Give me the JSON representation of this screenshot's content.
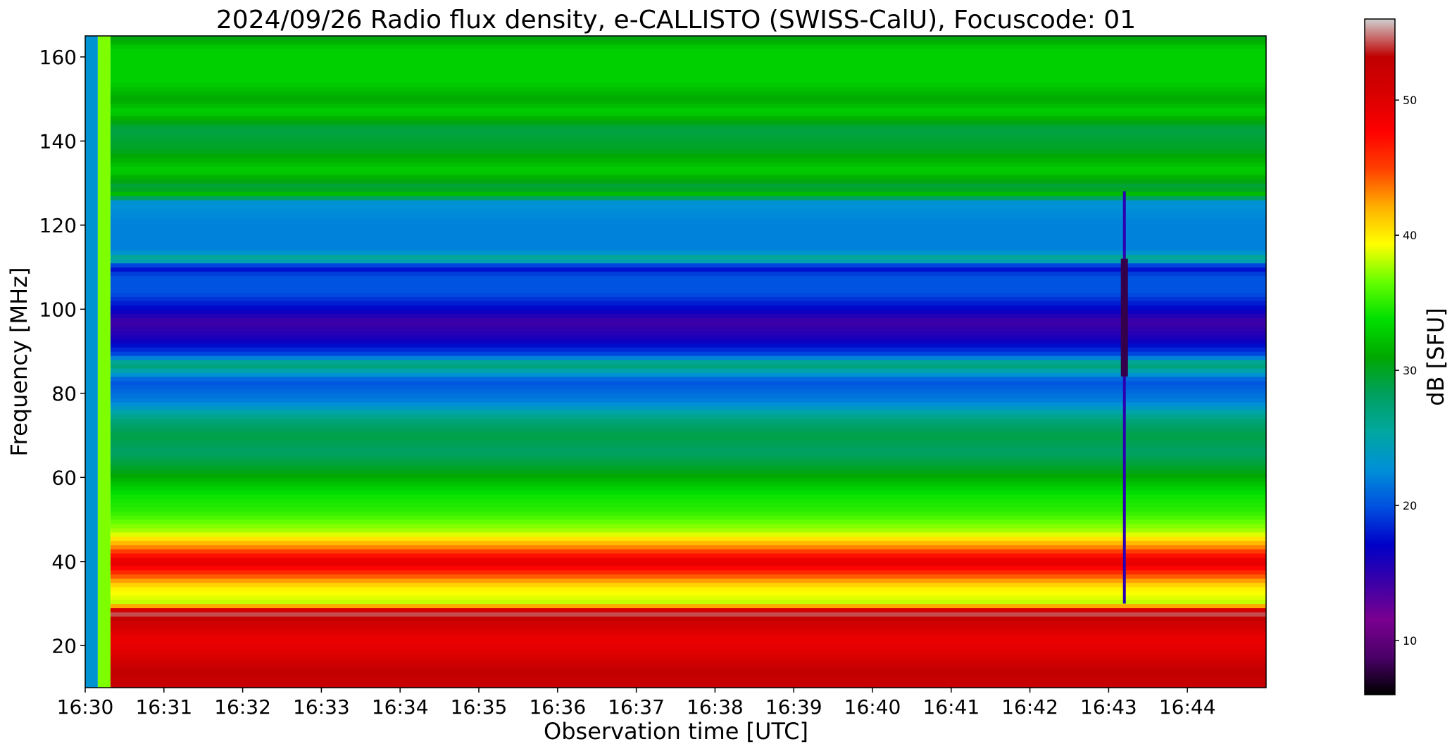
{
  "chart_data": {
    "type": "heatmap",
    "title": "2024/09/26  Radio flux density, e-CALLISTO (SWISS-CalU), Focuscode: 01",
    "xlabel": "Observation time [UTC]",
    "ylabel": "Frequency [MHz]",
    "colorbar_label": "dB [SFU]",
    "x_ticks": [
      "16:30",
      "16:31",
      "16:32",
      "16:33",
      "16:34",
      "16:35",
      "16:36",
      "16:37",
      "16:38",
      "16:39",
      "16:40",
      "16:41",
      "16:42",
      "16:43",
      "16:44"
    ],
    "x_range_minutes": [
      0,
      15
    ],
    "y_ticks": [
      20,
      40,
      60,
      80,
      100,
      120,
      140,
      160
    ],
    "ylim": [
      10,
      165
    ],
    "colorbar_ticks": [
      10,
      20,
      30,
      40,
      50
    ],
    "colorbar_range": [
      6,
      56
    ],
    "colormap": [
      "#000000",
      "#4a0068",
      "#7a0090",
      "#3a00a8",
      "#0000c8",
      "#0050e0",
      "#0090d8",
      "#00a8a0",
      "#00a060",
      "#00a800",
      "#00e000",
      "#66ff00",
      "#ffff00",
      "#ffb000",
      "#ff4000",
      "#ff0000",
      "#d80000",
      "#c00000",
      "#d0d0d0"
    ],
    "spectrum_profile": [
      {
        "freq": 10,
        "db": 52
      },
      {
        "freq": 14,
        "db": 53
      },
      {
        "freq": 18,
        "db": 50
      },
      {
        "freq": 22,
        "db": 49
      },
      {
        "freq": 26,
        "db": 52
      },
      {
        "freq": 28,
        "db": 55
      },
      {
        "freq": 30,
        "db": 38
      },
      {
        "freq": 34,
        "db": 40
      },
      {
        "freq": 37,
        "db": 45
      },
      {
        "freq": 40,
        "db": 50
      },
      {
        "freq": 43,
        "db": 44
      },
      {
        "freq": 47,
        "db": 38
      },
      {
        "freq": 52,
        "db": 35
      },
      {
        "freq": 56,
        "db": 34
      },
      {
        "freq": 62,
        "db": 30
      },
      {
        "freq": 66,
        "db": 28
      },
      {
        "freq": 70,
        "db": 29
      },
      {
        "freq": 74,
        "db": 27
      },
      {
        "freq": 78,
        "db": 22
      },
      {
        "freq": 83,
        "db": 20
      },
      {
        "freq": 87,
        "db": 28
      },
      {
        "freq": 89,
        "db": 20
      },
      {
        "freq": 93,
        "db": 16
      },
      {
        "freq": 97,
        "db": 14
      },
      {
        "freq": 100,
        "db": 17
      },
      {
        "freq": 104,
        "db": 20
      },
      {
        "freq": 108,
        "db": 20
      },
      {
        "freq": 110,
        "db": 17
      },
      {
        "freq": 112,
        "db": 27
      },
      {
        "freq": 114,
        "db": 22
      },
      {
        "freq": 120,
        "db": 22
      },
      {
        "freq": 126,
        "db": 23
      },
      {
        "freq": 127,
        "db": 33
      },
      {
        "freq": 129,
        "db": 29
      },
      {
        "freq": 133,
        "db": 33
      },
      {
        "freq": 138,
        "db": 30
      },
      {
        "freq": 143,
        "db": 29
      },
      {
        "freq": 147,
        "db": 33
      },
      {
        "freq": 150,
        "db": 31
      },
      {
        "freq": 154,
        "db": 33
      },
      {
        "freq": 158,
        "db": 33
      },
      {
        "freq": 162,
        "db": 33
      },
      {
        "freq": 165,
        "db": 30
      }
    ],
    "dropout_minutes": [
      0.0,
      0.16
    ],
    "bright_column_minutes": [
      0.16,
      0.32
    ],
    "burst_minutes": 13.2
  }
}
